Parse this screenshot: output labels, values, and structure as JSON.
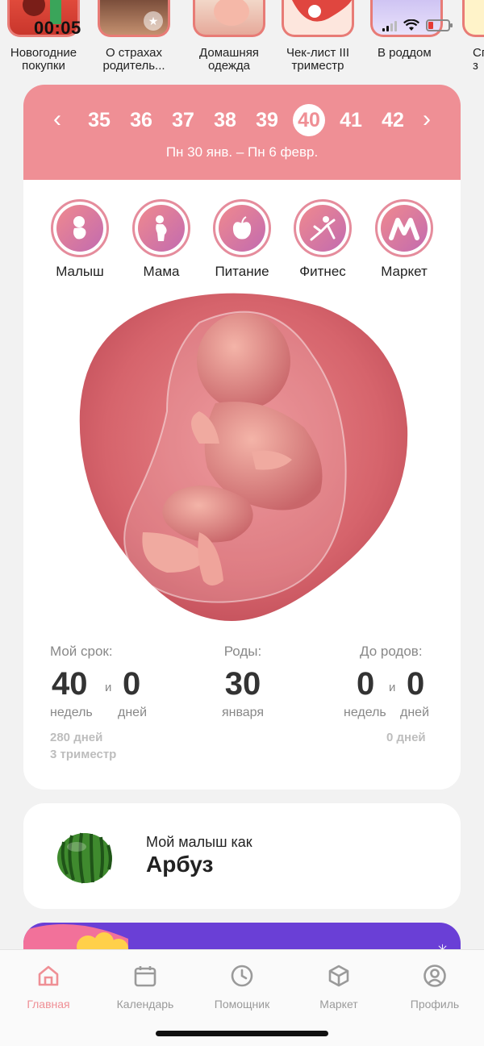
{
  "status_bar": {
    "time": "00:05"
  },
  "stories": [
    {
      "label_line1": "Новогодние",
      "label_line2": "покупки"
    },
    {
      "label_line1": "О страхах",
      "label_line2": "родитель..."
    },
    {
      "label_line1": "Домашняя",
      "label_line2": "одежда"
    },
    {
      "label_line1": "Чек-лист III",
      "label_line2": "триместр"
    },
    {
      "label_line1": "В роддом",
      "label_line2": ""
    },
    {
      "label_line1": "Сп",
      "label_line2": "з"
    }
  ],
  "week_selector": {
    "weeks": [
      "35",
      "36",
      "37",
      "38",
      "39",
      "40",
      "41",
      "42"
    ],
    "active_week": "40",
    "prev_icon": "chevron-left",
    "next_icon": "chevron-right",
    "date_range": "Пн 30 янв. – Пн 6 февр."
  },
  "categories": [
    {
      "label": "Малыш",
      "icon": "baby-icon"
    },
    {
      "label": "Мама",
      "icon": "pregnant-woman-icon"
    },
    {
      "label": "Питание",
      "icon": "apple-icon"
    },
    {
      "label": "Фитнес",
      "icon": "fitness-icon"
    },
    {
      "label": "Маркет",
      "icon": "market-icon"
    }
  ],
  "stats": {
    "my_term": {
      "title": "Мой срок:",
      "weeks": "40",
      "and": "и",
      "days": "0",
      "weeks_unit": "недель",
      "days_unit": "дней",
      "total_days": "280 дней",
      "trimester": "3 триместр"
    },
    "birth": {
      "title": "Роды:",
      "day": "30",
      "month": "января"
    },
    "until_birth": {
      "title": "До родов:",
      "weeks": "0",
      "and": "и",
      "days": "0",
      "weeks_unit": "недель",
      "days_unit": "дней",
      "total_days": "0 дней"
    }
  },
  "baby_size": {
    "prefix": "Мой малыш как",
    "fruit": "Арбуз"
  },
  "bottom_nav": [
    {
      "label": "Главная",
      "icon": "home-icon",
      "active": true
    },
    {
      "label": "Календарь",
      "icon": "calendar-icon",
      "active": false
    },
    {
      "label": "Помощник",
      "icon": "clock-icon",
      "active": false
    },
    {
      "label": "Маркет",
      "icon": "box-icon",
      "active": false
    },
    {
      "label": "Профиль",
      "icon": "profile-icon",
      "active": false
    }
  ],
  "colors": {
    "accent": "#ef8f95",
    "gradient_end": "#c26bb0",
    "nav_inactive": "#9a9a9a",
    "promo": "#6a3fd6"
  }
}
